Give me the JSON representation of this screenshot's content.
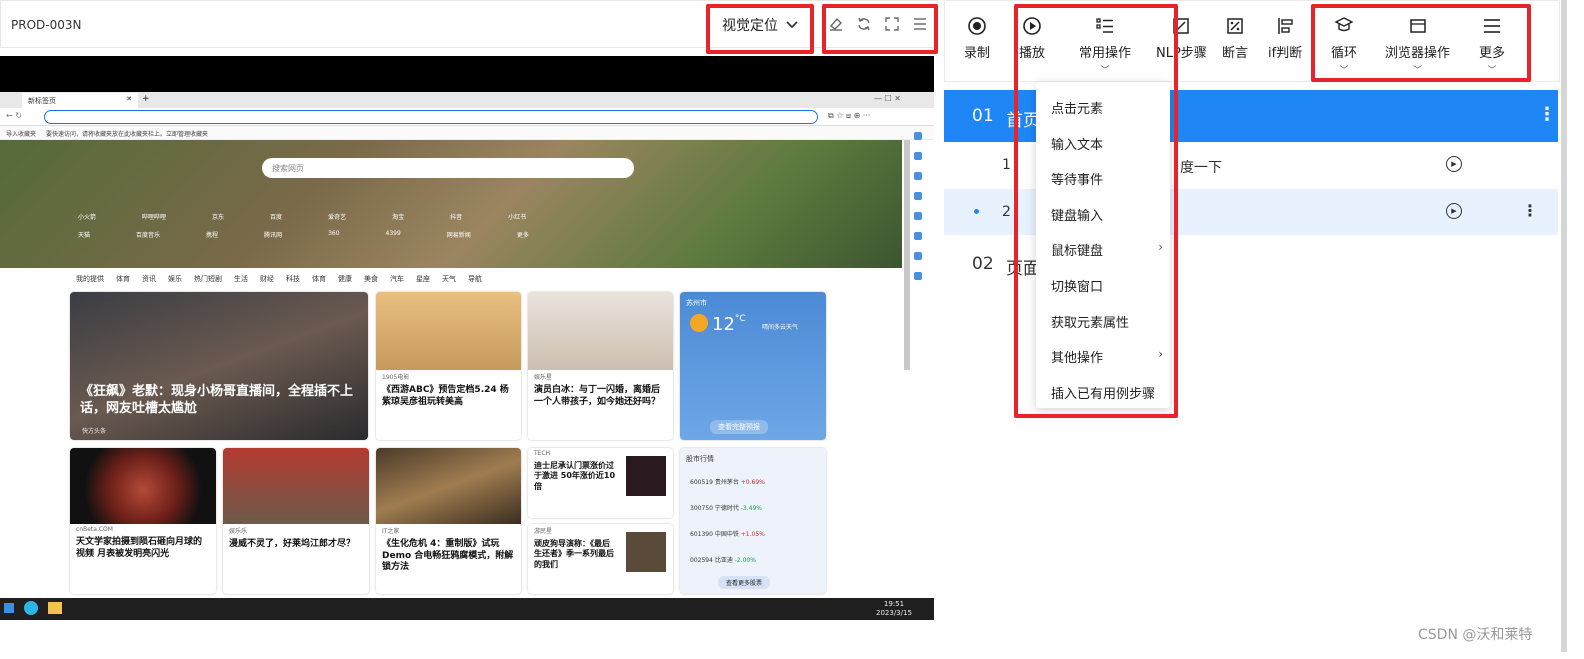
{
  "left": {
    "device_id": "PROD-003N",
    "mode_select": "视觉定位"
  },
  "browser": {
    "tab_title": "新标签页",
    "favbar_import": "导入收藏夹",
    "favbar_hint": "要快速访问，请将收藏夹放在此收藏夹栏上。立即管理收藏夹",
    "search_placeholder": "搜索网页",
    "hero_row1": [
      "小火箭",
      "哔哩哔哩",
      "京东",
      "百度",
      "爱奇艺",
      "淘宝",
      "抖音",
      "小红书"
    ],
    "hero_row2": [
      "天猫",
      "百度音乐",
      "携程",
      "腾讯网",
      "360",
      "4399",
      "网易新闻",
      "更多"
    ],
    "feed_tabs": [
      "我的提供",
      "体育",
      "资讯",
      "娱乐",
      "热门短剧",
      "生活",
      "财经",
      "科技",
      "体育",
      "健康",
      "美食",
      "汽车",
      "星座",
      "天气",
      "导航"
    ],
    "cards": [
      {
        "title": "《狂飙》老默：现身小杨哥直播间，全程插不上话，网友吐槽太尴尬",
        "source": "快方头条"
      },
      {
        "title": "《西游ABC》预告定档5.24 杨紫琼吴彦祖玩转美高",
        "source": "1905电影"
      },
      {
        "title": "演员白冰：与丁一闪婚，离婚后一个人带孩子，如今她还好吗？",
        "source": "娱乐星"
      },
      {
        "title": "天文学家拍摄到陨石砸向月球的视频 月表被发明亮闪光",
        "source": "cnBeta.COM"
      },
      {
        "title": "漫威不灵了，好莱坞江郎才尽？",
        "source": "娱乐乐"
      },
      {
        "title": "《生化危机 4：重制版》试玩 Demo 合电畅狂鸦腐模式，附解锁方法",
        "source": "IT之家"
      },
      {
        "title": "迪士尼承认门票涨价过于激进 50年涨价近10倍",
        "source": "TECH"
      },
      {
        "title": "顽皮狗导演称：《最后生还者》季一系列最后的我们",
        "source": "游民星"
      }
    ],
    "weather": {
      "city": "苏州市",
      "temp": "12",
      "unit": "°C",
      "detail": "查看完整预报",
      "link": "晴间多云天气"
    },
    "stocks": {
      "header": "股市行情",
      "items": [
        {
          "code": "600519",
          "name": "贵州茅台",
          "change": "+0.69%"
        },
        {
          "code": "300750",
          "name": "宁德时代",
          "change": "-3.49%"
        },
        {
          "code": "601390",
          "name": "中国中铁",
          "change": "+1.05%"
        },
        {
          "code": "002594",
          "name": "比亚迪",
          "change": "-2.00%"
        }
      ],
      "footer": "查看更多股票"
    },
    "taskbar_time": "19:51",
    "taskbar_date": "2023/3/15"
  },
  "toolbar": {
    "items": [
      {
        "label": "录制",
        "icon": "record-icon"
      },
      {
        "label": "播放",
        "icon": "play-icon"
      },
      {
        "label": "常用操作",
        "icon": "list-icon"
      },
      {
        "label": "NLP步骤",
        "icon": "nlp-icon"
      },
      {
        "label": "断言",
        "icon": "assert-icon"
      },
      {
        "label": "if判断",
        "icon": "if-icon"
      },
      {
        "label": "循环",
        "icon": "loop-icon"
      },
      {
        "label": "浏览器操作",
        "icon": "browser-icon"
      },
      {
        "label": "更多",
        "icon": "menu-icon"
      }
    ]
  },
  "steps": {
    "group1": {
      "num": "01",
      "title": "首页"
    },
    "rows": [
      {
        "num": "1",
        "text": "度一下"
      },
      {
        "num": "2",
        "text": ""
      }
    ],
    "group2": {
      "num": "02",
      "title": "页面"
    }
  },
  "menu": {
    "items": [
      {
        "label": "点击元素",
        "submenu": false
      },
      {
        "label": "输入文本",
        "submenu": false
      },
      {
        "label": "等待事件",
        "submenu": false
      },
      {
        "label": "键盘输入",
        "submenu": false
      },
      {
        "label": "鼠标键盘",
        "submenu": true
      },
      {
        "label": "切换窗口",
        "submenu": false
      },
      {
        "label": "获取元素属性",
        "submenu": false
      },
      {
        "label": "其他操作",
        "submenu": true
      },
      {
        "label": "插入已有用例步骤",
        "submenu": false
      }
    ]
  },
  "watermark": "CSDN @沃和莱特",
  "colors": {
    "accent": "#1f86f5",
    "highlight": "#e8232a",
    "selected_row": "#e8f1fe"
  }
}
